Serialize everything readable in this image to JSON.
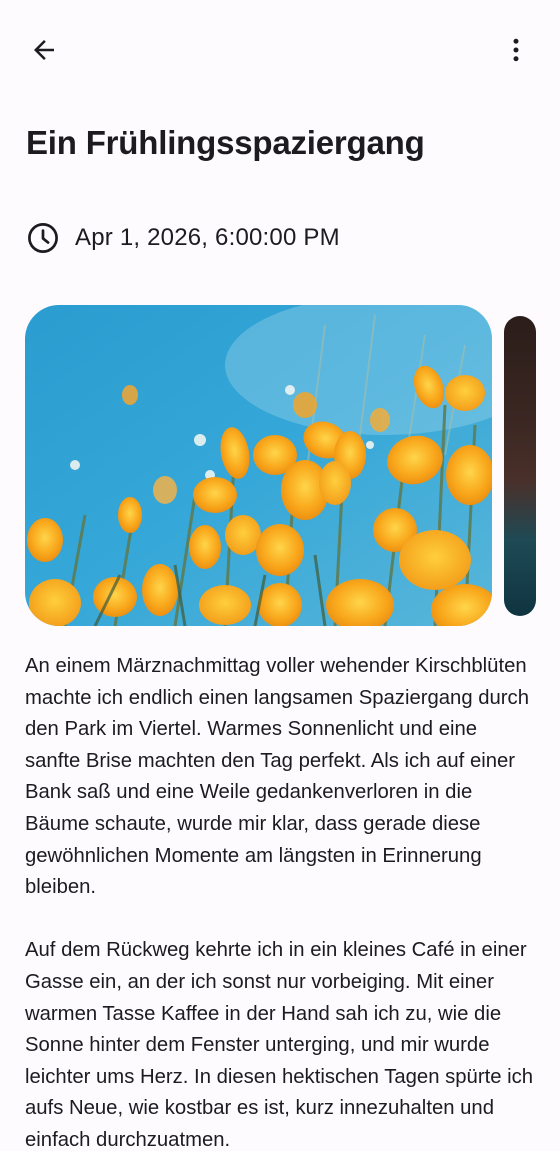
{
  "appbar": {
    "back_icon": "arrow-back-icon",
    "menu_icon": "more-vert-icon"
  },
  "post": {
    "title": "Ein Frühlingsspaziergang",
    "date_icon": "clock-icon",
    "date": "Apr 1, 2026, 6:00:00 PM",
    "images": [
      {
        "subject": "orange poppies against blue sky"
      },
      {
        "subject": "dark landscape (partially visible)"
      }
    ],
    "paragraphs": [
      "An einem Märznachmittag voller wehender Kirschblüten machte ich endlich einen langsamen Spaziergang durch den Park im Viertel. Warmes Sonnenlicht und eine sanfte Brise machten den Tag perfekt. Als ich auf einer Bank saß und eine Weile gedankenverloren in die Bäume schaute, wurde mir klar, dass gerade diese gewöhnlichen Momente am längsten in Erinnerung bleiben.",
      "Auf dem Rückweg kehrte ich in ein kleines Café in einer Gasse ein, an der ich sonst nur vorbeiging. Mit einer warmen Tasse Kaffee in der Hand sah ich zu, wie die Sonne hinter dem Fenster unterging, und mir wurde leichter ums Herz. In diesen hektischen Tagen spürte ich aufs Neue, wie kostbar es ist, kurz innezuhalten und einfach durchzuatmen."
    ]
  },
  "colors": {
    "background": "#fdfbfe",
    "text": "#1c1b1f",
    "sky": "#2f9fd3",
    "poppy": "#f5a623"
  }
}
